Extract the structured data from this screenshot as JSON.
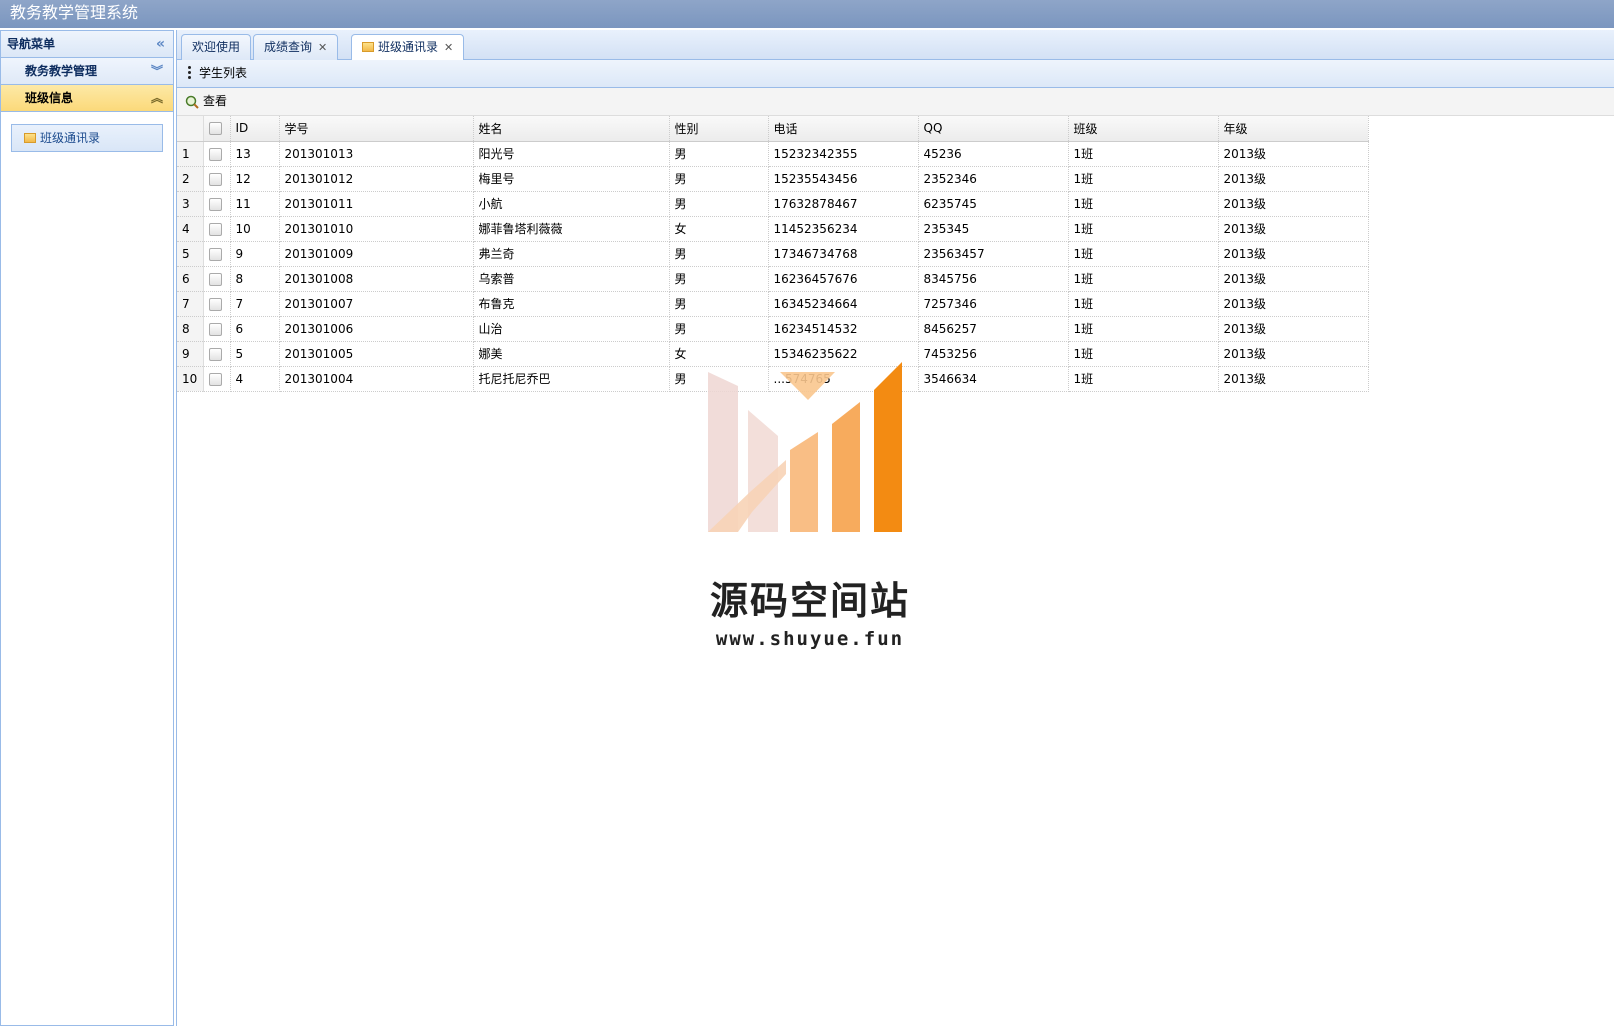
{
  "app": {
    "title": "教务教学管理系统"
  },
  "sidebar": {
    "header": "导航菜单",
    "groups": [
      {
        "label": "教务教学管理"
      },
      {
        "label": "班级信息"
      }
    ],
    "links": [
      {
        "label": "班级通讯录"
      }
    ]
  },
  "tabs": [
    {
      "label": "欢迎使用"
    },
    {
      "label": "成绩查询"
    },
    {
      "label": "班级通讯录"
    }
  ],
  "panel": {
    "title": "学生列表"
  },
  "toolbar": {
    "view_label": "查看"
  },
  "table": {
    "columns": [
      "ID",
      "学号",
      "姓名",
      "性别",
      "电话",
      "QQ",
      "班级",
      "年级"
    ],
    "rows": [
      {
        "n": "1",
        "id": "13",
        "sno": "201301013",
        "name": "阳光号",
        "sex": "男",
        "phone": "15232342355",
        "qq": "45236",
        "cls": "1班",
        "grade": "2013级"
      },
      {
        "n": "2",
        "id": "12",
        "sno": "201301012",
        "name": "梅里号",
        "sex": "男",
        "phone": "15235543456",
        "qq": "2352346",
        "cls": "1班",
        "grade": "2013级"
      },
      {
        "n": "3",
        "id": "11",
        "sno": "201301011",
        "name": "小航",
        "sex": "男",
        "phone": "17632878467",
        "qq": "6235745",
        "cls": "1班",
        "grade": "2013级"
      },
      {
        "n": "4",
        "id": "10",
        "sno": "201301010",
        "name": "娜菲鲁塔利薇薇",
        "sex": "女",
        "phone": "11452356234",
        "qq": "235345",
        "cls": "1班",
        "grade": "2013级"
      },
      {
        "n": "5",
        "id": "9",
        "sno": "201301009",
        "name": "弗兰奇",
        "sex": "男",
        "phone": "17346734768",
        "qq": "23563457",
        "cls": "1班",
        "grade": "2013级"
      },
      {
        "n": "6",
        "id": "8",
        "sno": "201301008",
        "name": "乌索普",
        "sex": "男",
        "phone": "16236457676",
        "qq": "8345756",
        "cls": "1班",
        "grade": "2013级"
      },
      {
        "n": "7",
        "id": "7",
        "sno": "201301007",
        "name": "布鲁克",
        "sex": "男",
        "phone": "16345234664",
        "qq": "7257346",
        "cls": "1班",
        "grade": "2013级"
      },
      {
        "n": "8",
        "id": "6",
        "sno": "201301006",
        "name": "山治",
        "sex": "男",
        "phone": "16234514532",
        "qq": "8456257",
        "cls": "1班",
        "grade": "2013级"
      },
      {
        "n": "9",
        "id": "5",
        "sno": "201301005",
        "name": "娜美",
        "sex": "女",
        "phone": "15346235622",
        "qq": "7453256",
        "cls": "1班",
        "grade": "2013级"
      },
      {
        "n": "10",
        "id": "4",
        "sno": "201301004",
        "name": "托尼托尼乔巴",
        "sex": "男",
        "phone": "...574765",
        "qq": "3546634",
        "cls": "1班",
        "grade": "2013级"
      }
    ]
  },
  "watermark": {
    "name": "源码空间站",
    "url": "www.shuyue.fun"
  },
  "colors": {
    "accent": "#99bbe8",
    "active_group": "#fbd97a",
    "logo_orange": "#f38b12"
  }
}
